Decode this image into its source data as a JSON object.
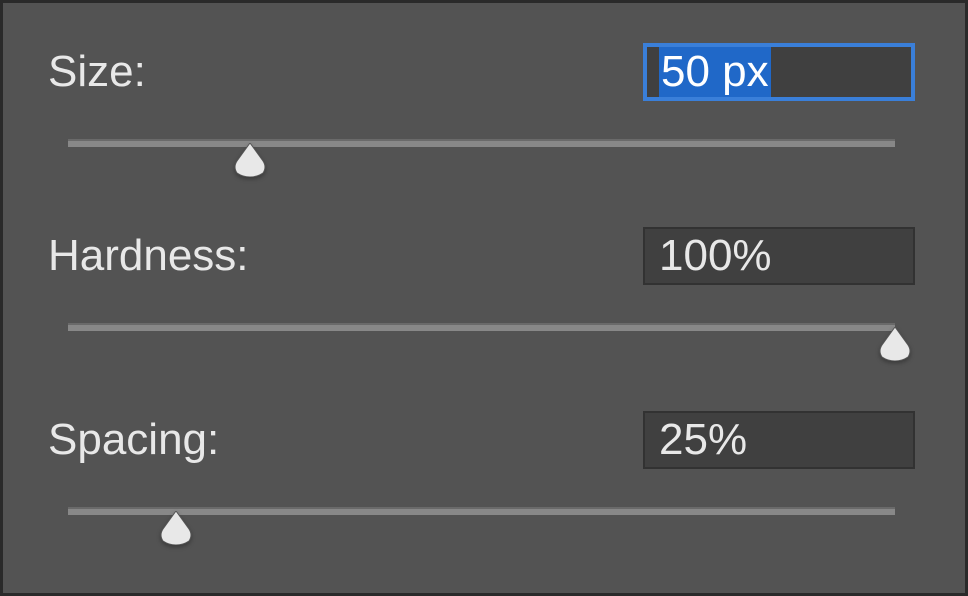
{
  "controls": {
    "size": {
      "label": "Size:",
      "value": "50 px",
      "slider_percent": 22,
      "focused": true
    },
    "hardness": {
      "label": "Hardness:",
      "value": "100%",
      "slider_percent": 100,
      "focused": false
    },
    "spacing": {
      "label": "Spacing:",
      "value": "25%",
      "slider_percent": 13,
      "focused": false
    }
  }
}
